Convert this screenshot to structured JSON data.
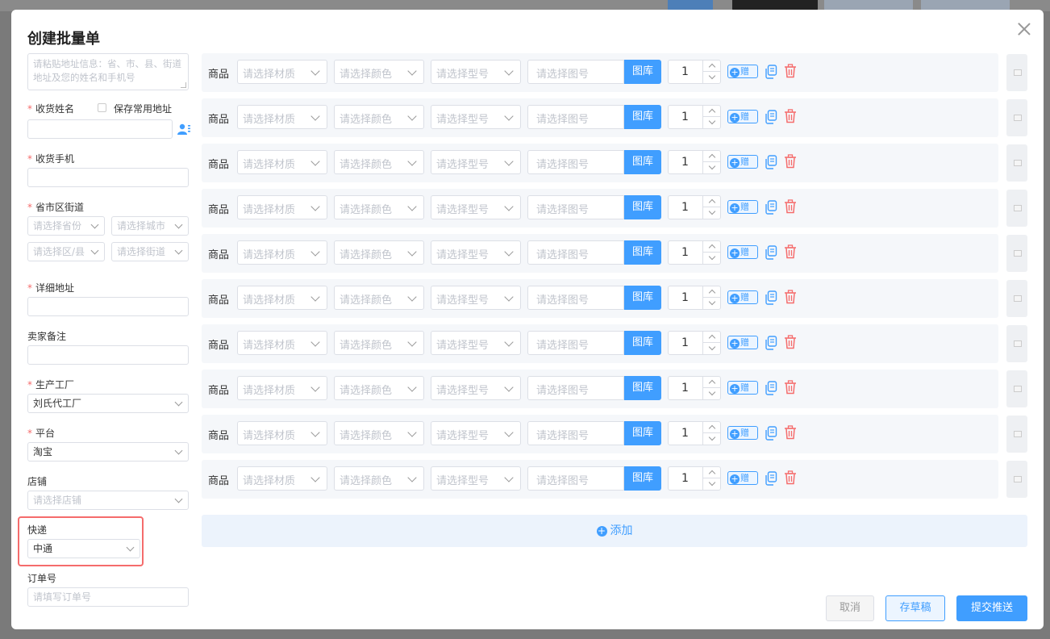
{
  "modal": {
    "title": "创建批量单"
  },
  "form": {
    "paste_placeholder": "请粘贴地址信息：省、市、县、街道地址及您的姓名和手机号",
    "receiver_name_label": "收货姓名",
    "save_address_label": "保存常用地址",
    "receiver_phone_label": "收货手机",
    "region_label": "省市区街道",
    "province_placeholder": "请选择省份",
    "city_placeholder": "请选择城市",
    "district_placeholder": "请选择区/县",
    "street_placeholder": "请选择街道",
    "address_label": "详细地址",
    "remark_label": "卖家备注",
    "factory_label": "生产工厂",
    "factory_value": "刘氏代工厂",
    "platform_label": "平台",
    "platform_value": "淘宝",
    "shop_label": "店铺",
    "shop_placeholder": "请选择店铺",
    "express_label": "快递",
    "express_value": "中通",
    "order_label": "订单号",
    "order_placeholder": "请填写订单号"
  },
  "product_row": {
    "label": "商品",
    "material_placeholder": "请选择材质",
    "color_placeholder": "请选择颜色",
    "model_placeholder": "请选择型号",
    "pattern_placeholder": "请选择图号",
    "gallery_label": "图库",
    "gift_label": "赠"
  },
  "products": [
    {
      "qty": "1"
    },
    {
      "qty": "1"
    },
    {
      "qty": "1"
    },
    {
      "qty": "1"
    },
    {
      "qty": "1"
    },
    {
      "qty": "1"
    },
    {
      "qty": "1"
    },
    {
      "qty": "1"
    },
    {
      "qty": "1"
    },
    {
      "qty": "1"
    }
  ],
  "add_label": "添加",
  "buttons": {
    "cancel": "取消",
    "draft": "存草稿",
    "submit": "提交推送"
  },
  "colors": {
    "primary": "#409eff",
    "danger": "#f56c6c"
  }
}
